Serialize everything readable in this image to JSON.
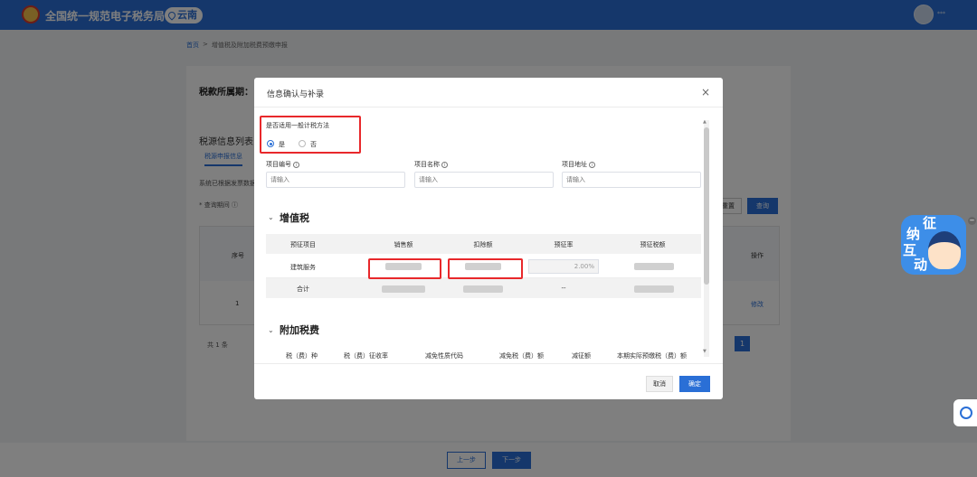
{
  "header": {
    "site_title": "全国统一规范电子税务局",
    "region": "云南",
    "user_name": "***"
  },
  "breadcrumb": {
    "home": "首页",
    "separator": ">",
    "current": "增值税及附加税费预缴申报"
  },
  "page": {
    "period_label": "税款所属期：",
    "section_title": "税源信息列表",
    "tab": "税源申报信息",
    "note": "系统已根据发票数据…",
    "query_label": "* 查询期间 ⓘ",
    "reset_btn": "重置",
    "query_btn": "查询",
    "col_seq": "序号",
    "col_op": "操作",
    "row_num": "1",
    "row_edit": "修改",
    "total_count": "共 1 条",
    "page_number": "1",
    "prev_btn": "上一步",
    "next_btn": "下一步"
  },
  "mascot": {
    "chars": [
      "纳",
      "征",
      "互",
      "动"
    ]
  },
  "modal": {
    "title": "信息确认与补录",
    "close": "×",
    "question": "是否适用一般计税方法",
    "option_yes": "是",
    "option_no": "否",
    "selected": "是",
    "fields": [
      {
        "label": "项目编号",
        "placeholder": "请输入"
      },
      {
        "label": "项目名称",
        "placeholder": "请输入"
      },
      {
        "label": "项目地址",
        "placeholder": "请输入"
      }
    ],
    "vat_section": "增值税",
    "vat_table": {
      "headers": [
        "预征项目",
        "销售额",
        "扣除额",
        "预征率",
        "预征税额"
      ],
      "row_item": "建筑服务",
      "row_rate": "2.00%",
      "total_label": "合计",
      "total_rate": "--"
    },
    "surcharge_section": "附加税费",
    "surcharge_headers": [
      "税（费）种",
      "税（费）征收率",
      "减免性质代码",
      "减免税（费）额",
      "减征额",
      "本期实际预缴税（费）额"
    ],
    "cancel_btn": "取消",
    "ok_btn": "确定"
  },
  "colors": {
    "primary": "#2a6fd6",
    "highlight_border": "#e8282b"
  }
}
